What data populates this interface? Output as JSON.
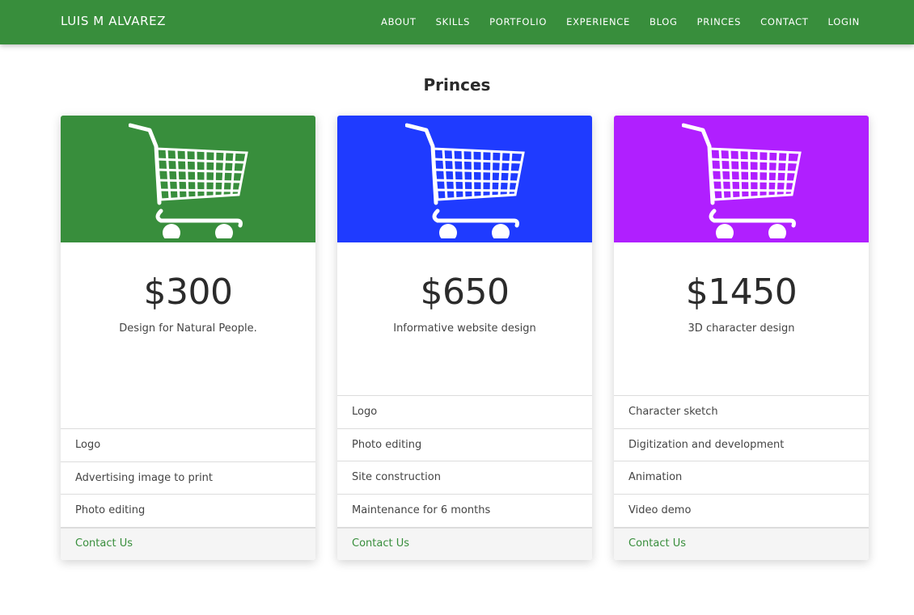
{
  "brand": "LUIS M ALVAREZ",
  "nav": [
    "ABOUT",
    "SKILLS",
    "PORTFOLIO",
    "EXPERIENCE",
    "BLOG",
    "PRINCES",
    "CONTACT",
    "LOGIN"
  ],
  "section_title": "Princes",
  "colors": {
    "navbar": "#388e3c",
    "accent": "#388e3c"
  },
  "cards": [
    {
      "icon": "shopping-cart-icon",
      "color": "#388e3c",
      "price": "$300",
      "description": "Design for Natural People.",
      "features": [
        "Logo",
        "Advertising image to print",
        "Photo editing"
      ],
      "cta": "Contact Us"
    },
    {
      "icon": "shopping-cart-icon",
      "color": "#1f3bff",
      "price": "$650",
      "description": "Informative website design",
      "features": [
        "Logo",
        "Photo editing",
        "Site construction",
        "Maintenance for 6 months"
      ],
      "cta": "Contact Us"
    },
    {
      "icon": "shopping-cart-icon",
      "color": "#b01fff",
      "price": "$1450",
      "description": "3D character design",
      "features": [
        "Character sketch",
        "Digitization and development",
        "Animation",
        "Video demo"
      ],
      "cta": "Contact Us"
    }
  ]
}
